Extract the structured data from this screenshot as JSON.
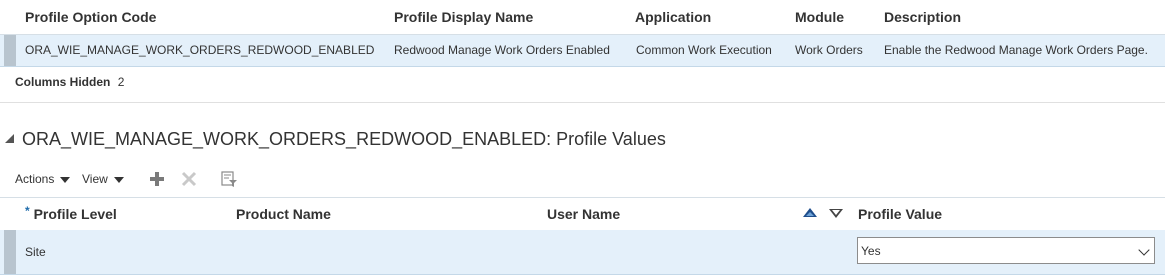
{
  "profile_table": {
    "columns": [
      "Profile Option Code",
      "Profile Display Name",
      "Application",
      "Module",
      "Description"
    ],
    "row": {
      "code": "ORA_WIE_MANAGE_WORK_ORDERS_REDWOOD_ENABLED",
      "display_name": "Redwood Manage Work Orders Enabled",
      "application": "Common Work Execution",
      "module": "Work Orders",
      "description": "Enable the Redwood Manage Work Orders Page."
    },
    "columns_hidden_label": "Columns Hidden",
    "columns_hidden_count": "2"
  },
  "values_section": {
    "title": "ORA_WIE_MANAGE_WORK_ORDERS_REDWOOD_ENABLED: Profile Values",
    "toolbar": {
      "actions_label": "Actions",
      "view_label": "View"
    },
    "columns": {
      "required_marker": "*",
      "profile_level": "Profile Level",
      "product_name": "Product Name",
      "user_name": "User Name",
      "profile_value": "Profile Value"
    },
    "row": {
      "profile_level": "Site",
      "product_name": "",
      "user_name": "",
      "profile_value": "Yes"
    }
  },
  "colors": {
    "selected_row": "#e4f0fa",
    "selection_bar": "#b8c4ce",
    "sort_ascending": "#1f4e8c"
  }
}
